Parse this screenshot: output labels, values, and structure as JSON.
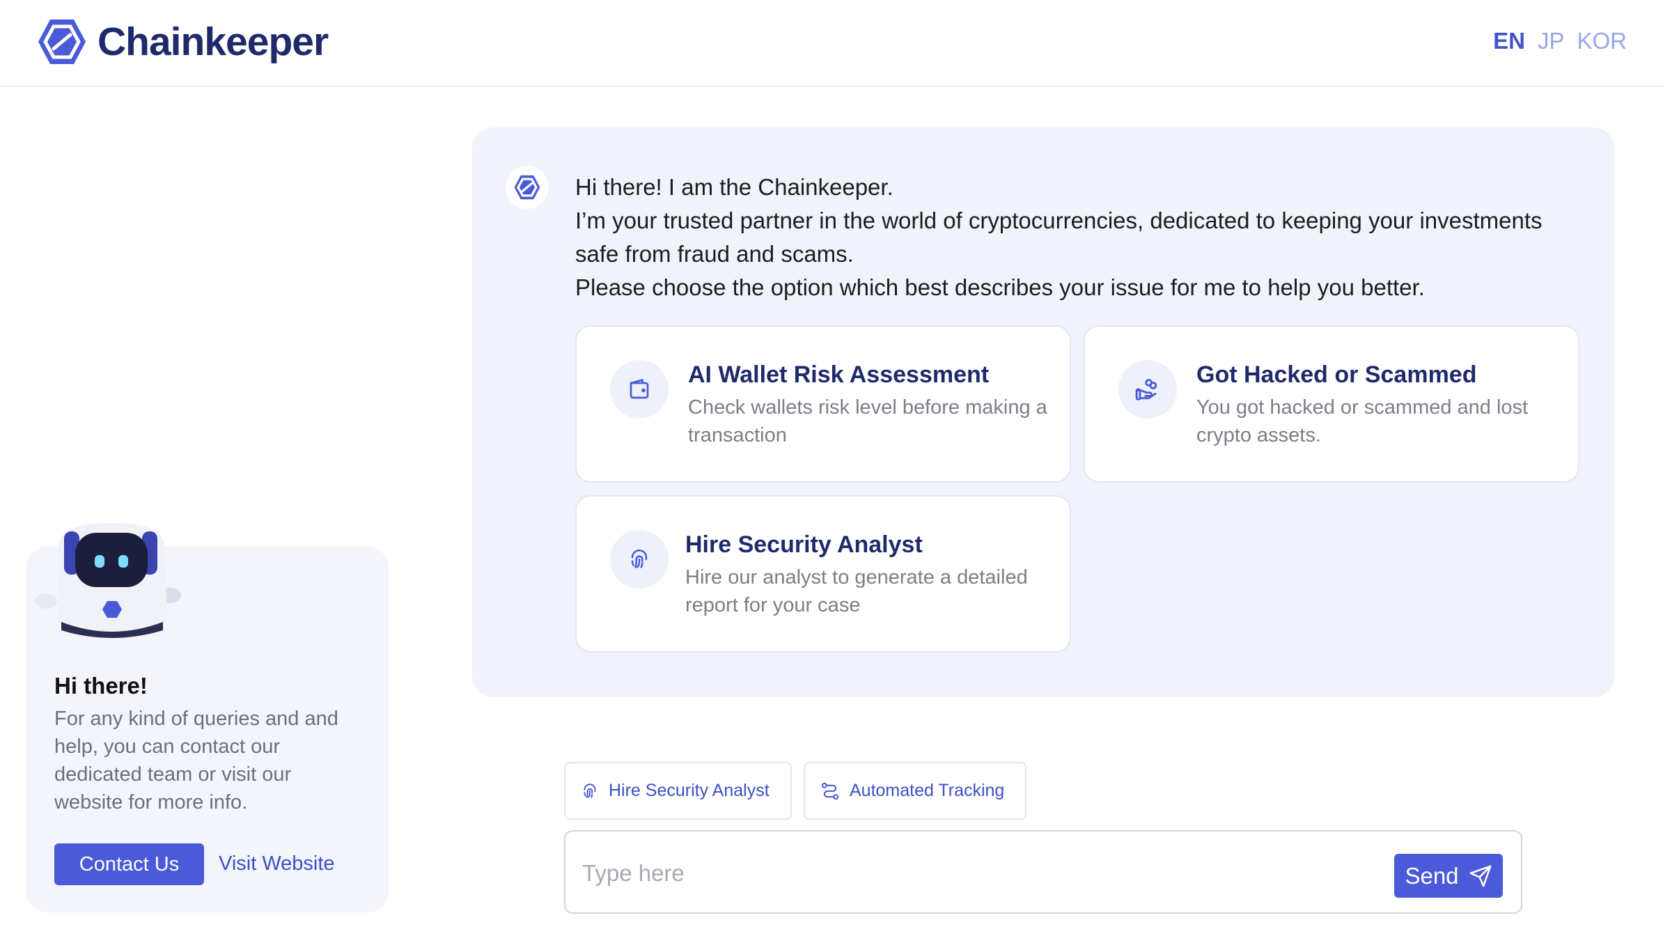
{
  "brand": {
    "name": "Chainkeeper",
    "accent": "#4a5ad9",
    "dark": "#1f2a6b"
  },
  "languages": [
    {
      "label": "EN",
      "active": true
    },
    {
      "label": "JP",
      "active": false
    },
    {
      "label": "KOR",
      "active": false
    }
  ],
  "help_card": {
    "title": "Hi there!",
    "text": "For any kind of queries and and help, you can contact our dedicated team or visit our website for more info.",
    "contact_label": "Contact Us",
    "visit_label": "Visit Website"
  },
  "chat": {
    "lines": [
      "Hi there! I am the Chainkeeper.",
      "I’m your trusted partner in the world of cryptocurrencies, dedicated to keeping your investments safe from fraud and scams.",
      "Please choose the option which best describes your issue for me to help you better."
    ],
    "options": [
      {
        "icon": "wallet-icon",
        "title": "AI Wallet Risk Assessment",
        "desc": "Check wallets risk level before making a transaction"
      },
      {
        "icon": "hand-coins-icon",
        "title": "Got Hacked or Scammed",
        "desc": "You got hacked or scammed and lost crypto assets."
      },
      {
        "icon": "fingerprint-icon",
        "title": "Hire Security Analyst",
        "desc": "Hire our analyst to generate a detailed report for your case"
      }
    ]
  },
  "chips": [
    {
      "icon": "fingerprint-icon",
      "label": "Hire Security Analyst"
    },
    {
      "icon": "route-icon",
      "label": "Automated Tracking"
    }
  ],
  "input": {
    "placeholder": "Type here",
    "value": "",
    "send_label": "Send"
  }
}
